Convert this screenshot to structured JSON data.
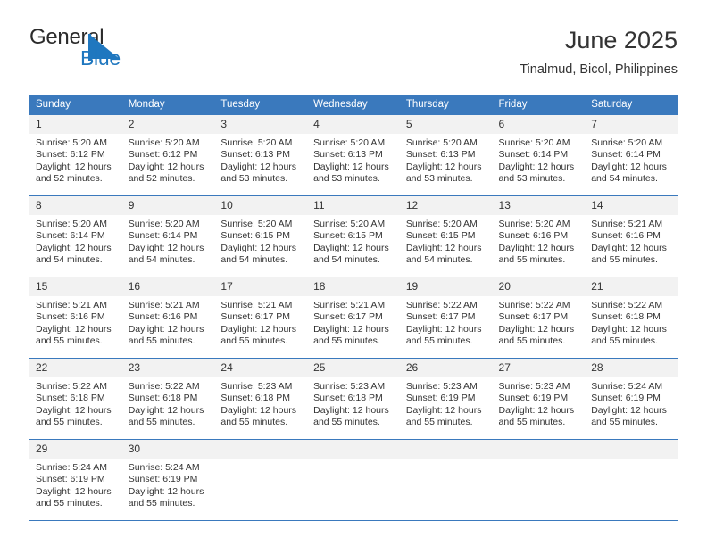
{
  "brand": {
    "name_primary": "General",
    "name_secondary": "Blue",
    "accent_color": "#1f77bf"
  },
  "header": {
    "title": "June 2025",
    "subtitle": "Tinalmud, Bicol, Philippines"
  },
  "theme": {
    "header_row_color": "#3a79bd",
    "daynum_band_color": "#f2f2f2",
    "text_color": "#333333"
  },
  "weekday_headers": [
    "Sunday",
    "Monday",
    "Tuesday",
    "Wednesday",
    "Thursday",
    "Friday",
    "Saturday"
  ],
  "weeks": [
    [
      {
        "day": "1",
        "sunrise": "Sunrise: 5:20 AM",
        "sunset": "Sunset: 6:12 PM",
        "daylight_line1": "Daylight: 12 hours",
        "daylight_line2": "and 52 minutes."
      },
      {
        "day": "2",
        "sunrise": "Sunrise: 5:20 AM",
        "sunset": "Sunset: 6:12 PM",
        "daylight_line1": "Daylight: 12 hours",
        "daylight_line2": "and 52 minutes."
      },
      {
        "day": "3",
        "sunrise": "Sunrise: 5:20 AM",
        "sunset": "Sunset: 6:13 PM",
        "daylight_line1": "Daylight: 12 hours",
        "daylight_line2": "and 53 minutes."
      },
      {
        "day": "4",
        "sunrise": "Sunrise: 5:20 AM",
        "sunset": "Sunset: 6:13 PM",
        "daylight_line1": "Daylight: 12 hours",
        "daylight_line2": "and 53 minutes."
      },
      {
        "day": "5",
        "sunrise": "Sunrise: 5:20 AM",
        "sunset": "Sunset: 6:13 PM",
        "daylight_line1": "Daylight: 12 hours",
        "daylight_line2": "and 53 minutes."
      },
      {
        "day": "6",
        "sunrise": "Sunrise: 5:20 AM",
        "sunset": "Sunset: 6:14 PM",
        "daylight_line1": "Daylight: 12 hours",
        "daylight_line2": "and 53 minutes."
      },
      {
        "day": "7",
        "sunrise": "Sunrise: 5:20 AM",
        "sunset": "Sunset: 6:14 PM",
        "daylight_line1": "Daylight: 12 hours",
        "daylight_line2": "and 54 minutes."
      }
    ],
    [
      {
        "day": "8",
        "sunrise": "Sunrise: 5:20 AM",
        "sunset": "Sunset: 6:14 PM",
        "daylight_line1": "Daylight: 12 hours",
        "daylight_line2": "and 54 minutes."
      },
      {
        "day": "9",
        "sunrise": "Sunrise: 5:20 AM",
        "sunset": "Sunset: 6:14 PM",
        "daylight_line1": "Daylight: 12 hours",
        "daylight_line2": "and 54 minutes."
      },
      {
        "day": "10",
        "sunrise": "Sunrise: 5:20 AM",
        "sunset": "Sunset: 6:15 PM",
        "daylight_line1": "Daylight: 12 hours",
        "daylight_line2": "and 54 minutes."
      },
      {
        "day": "11",
        "sunrise": "Sunrise: 5:20 AM",
        "sunset": "Sunset: 6:15 PM",
        "daylight_line1": "Daylight: 12 hours",
        "daylight_line2": "and 54 minutes."
      },
      {
        "day": "12",
        "sunrise": "Sunrise: 5:20 AM",
        "sunset": "Sunset: 6:15 PM",
        "daylight_line1": "Daylight: 12 hours",
        "daylight_line2": "and 54 minutes."
      },
      {
        "day": "13",
        "sunrise": "Sunrise: 5:20 AM",
        "sunset": "Sunset: 6:16 PM",
        "daylight_line1": "Daylight: 12 hours",
        "daylight_line2": "and 55 minutes."
      },
      {
        "day": "14",
        "sunrise": "Sunrise: 5:21 AM",
        "sunset": "Sunset: 6:16 PM",
        "daylight_line1": "Daylight: 12 hours",
        "daylight_line2": "and 55 minutes."
      }
    ],
    [
      {
        "day": "15",
        "sunrise": "Sunrise: 5:21 AM",
        "sunset": "Sunset: 6:16 PM",
        "daylight_line1": "Daylight: 12 hours",
        "daylight_line2": "and 55 minutes."
      },
      {
        "day": "16",
        "sunrise": "Sunrise: 5:21 AM",
        "sunset": "Sunset: 6:16 PM",
        "daylight_line1": "Daylight: 12 hours",
        "daylight_line2": "and 55 minutes."
      },
      {
        "day": "17",
        "sunrise": "Sunrise: 5:21 AM",
        "sunset": "Sunset: 6:17 PM",
        "daylight_line1": "Daylight: 12 hours",
        "daylight_line2": "and 55 minutes."
      },
      {
        "day": "18",
        "sunrise": "Sunrise: 5:21 AM",
        "sunset": "Sunset: 6:17 PM",
        "daylight_line1": "Daylight: 12 hours",
        "daylight_line2": "and 55 minutes."
      },
      {
        "day": "19",
        "sunrise": "Sunrise: 5:22 AM",
        "sunset": "Sunset: 6:17 PM",
        "daylight_line1": "Daylight: 12 hours",
        "daylight_line2": "and 55 minutes."
      },
      {
        "day": "20",
        "sunrise": "Sunrise: 5:22 AM",
        "sunset": "Sunset: 6:17 PM",
        "daylight_line1": "Daylight: 12 hours",
        "daylight_line2": "and 55 minutes."
      },
      {
        "day": "21",
        "sunrise": "Sunrise: 5:22 AM",
        "sunset": "Sunset: 6:18 PM",
        "daylight_line1": "Daylight: 12 hours",
        "daylight_line2": "and 55 minutes."
      }
    ],
    [
      {
        "day": "22",
        "sunrise": "Sunrise: 5:22 AM",
        "sunset": "Sunset: 6:18 PM",
        "daylight_line1": "Daylight: 12 hours",
        "daylight_line2": "and 55 minutes."
      },
      {
        "day": "23",
        "sunrise": "Sunrise: 5:22 AM",
        "sunset": "Sunset: 6:18 PM",
        "daylight_line1": "Daylight: 12 hours",
        "daylight_line2": "and 55 minutes."
      },
      {
        "day": "24",
        "sunrise": "Sunrise: 5:23 AM",
        "sunset": "Sunset: 6:18 PM",
        "daylight_line1": "Daylight: 12 hours",
        "daylight_line2": "and 55 minutes."
      },
      {
        "day": "25",
        "sunrise": "Sunrise: 5:23 AM",
        "sunset": "Sunset: 6:18 PM",
        "daylight_line1": "Daylight: 12 hours",
        "daylight_line2": "and 55 minutes."
      },
      {
        "day": "26",
        "sunrise": "Sunrise: 5:23 AM",
        "sunset": "Sunset: 6:19 PM",
        "daylight_line1": "Daylight: 12 hours",
        "daylight_line2": "and 55 minutes."
      },
      {
        "day": "27",
        "sunrise": "Sunrise: 5:23 AM",
        "sunset": "Sunset: 6:19 PM",
        "daylight_line1": "Daylight: 12 hours",
        "daylight_line2": "and 55 minutes."
      },
      {
        "day": "28",
        "sunrise": "Sunrise: 5:24 AM",
        "sunset": "Sunset: 6:19 PM",
        "daylight_line1": "Daylight: 12 hours",
        "daylight_line2": "and 55 minutes."
      }
    ],
    [
      {
        "day": "29",
        "sunrise": "Sunrise: 5:24 AM",
        "sunset": "Sunset: 6:19 PM",
        "daylight_line1": "Daylight: 12 hours",
        "daylight_line2": "and 55 minutes."
      },
      {
        "day": "30",
        "sunrise": "Sunrise: 5:24 AM",
        "sunset": "Sunset: 6:19 PM",
        "daylight_line1": "Daylight: 12 hours",
        "daylight_line2": "and 55 minutes."
      },
      {
        "day": "",
        "sunrise": "",
        "sunset": "",
        "daylight_line1": "",
        "daylight_line2": ""
      },
      {
        "day": "",
        "sunrise": "",
        "sunset": "",
        "daylight_line1": "",
        "daylight_line2": ""
      },
      {
        "day": "",
        "sunrise": "",
        "sunset": "",
        "daylight_line1": "",
        "daylight_line2": ""
      },
      {
        "day": "",
        "sunrise": "",
        "sunset": "",
        "daylight_line1": "",
        "daylight_line2": ""
      },
      {
        "day": "",
        "sunrise": "",
        "sunset": "",
        "daylight_line1": "",
        "daylight_line2": ""
      }
    ]
  ]
}
